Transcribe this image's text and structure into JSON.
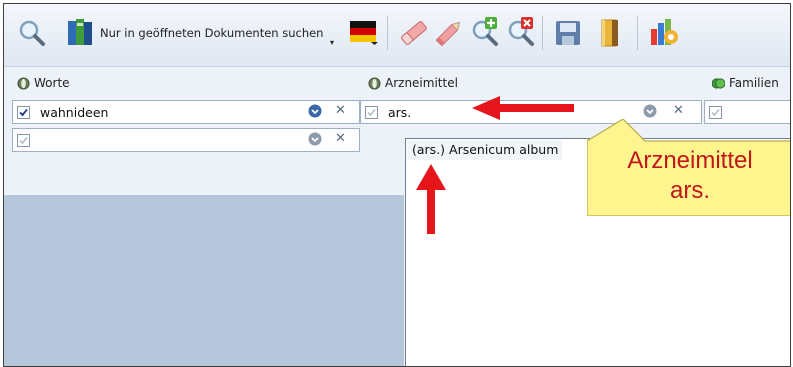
{
  "toolbar": {
    "search_label": "Nur in geöffneten Dokumenten suchen",
    "icons": [
      "search-icon",
      "books-icon",
      "flag-de-icon",
      "eraser-icon",
      "pencil-icon",
      "zoom-add-icon",
      "zoom-remove-icon",
      "save-icon",
      "book-icon",
      "chart-icon"
    ]
  },
  "columns": {
    "worte": {
      "label": "Worte"
    },
    "arzneimittel": {
      "label": "Arzneimittel"
    },
    "familien": {
      "label": "Familien"
    }
  },
  "fields": {
    "worte_row1": "wahnideen",
    "worte_row2": "",
    "arznei_row1": "ars."
  },
  "dropdown": {
    "items": [
      "(ars.) Arsenicum album"
    ]
  },
  "callout": {
    "line1": "Arzneimittel",
    "line2": "ars."
  },
  "colors": {
    "accent_red": "#e5161b",
    "callout_fill": "#fff58f",
    "panel_blue": "#b7c7db"
  }
}
